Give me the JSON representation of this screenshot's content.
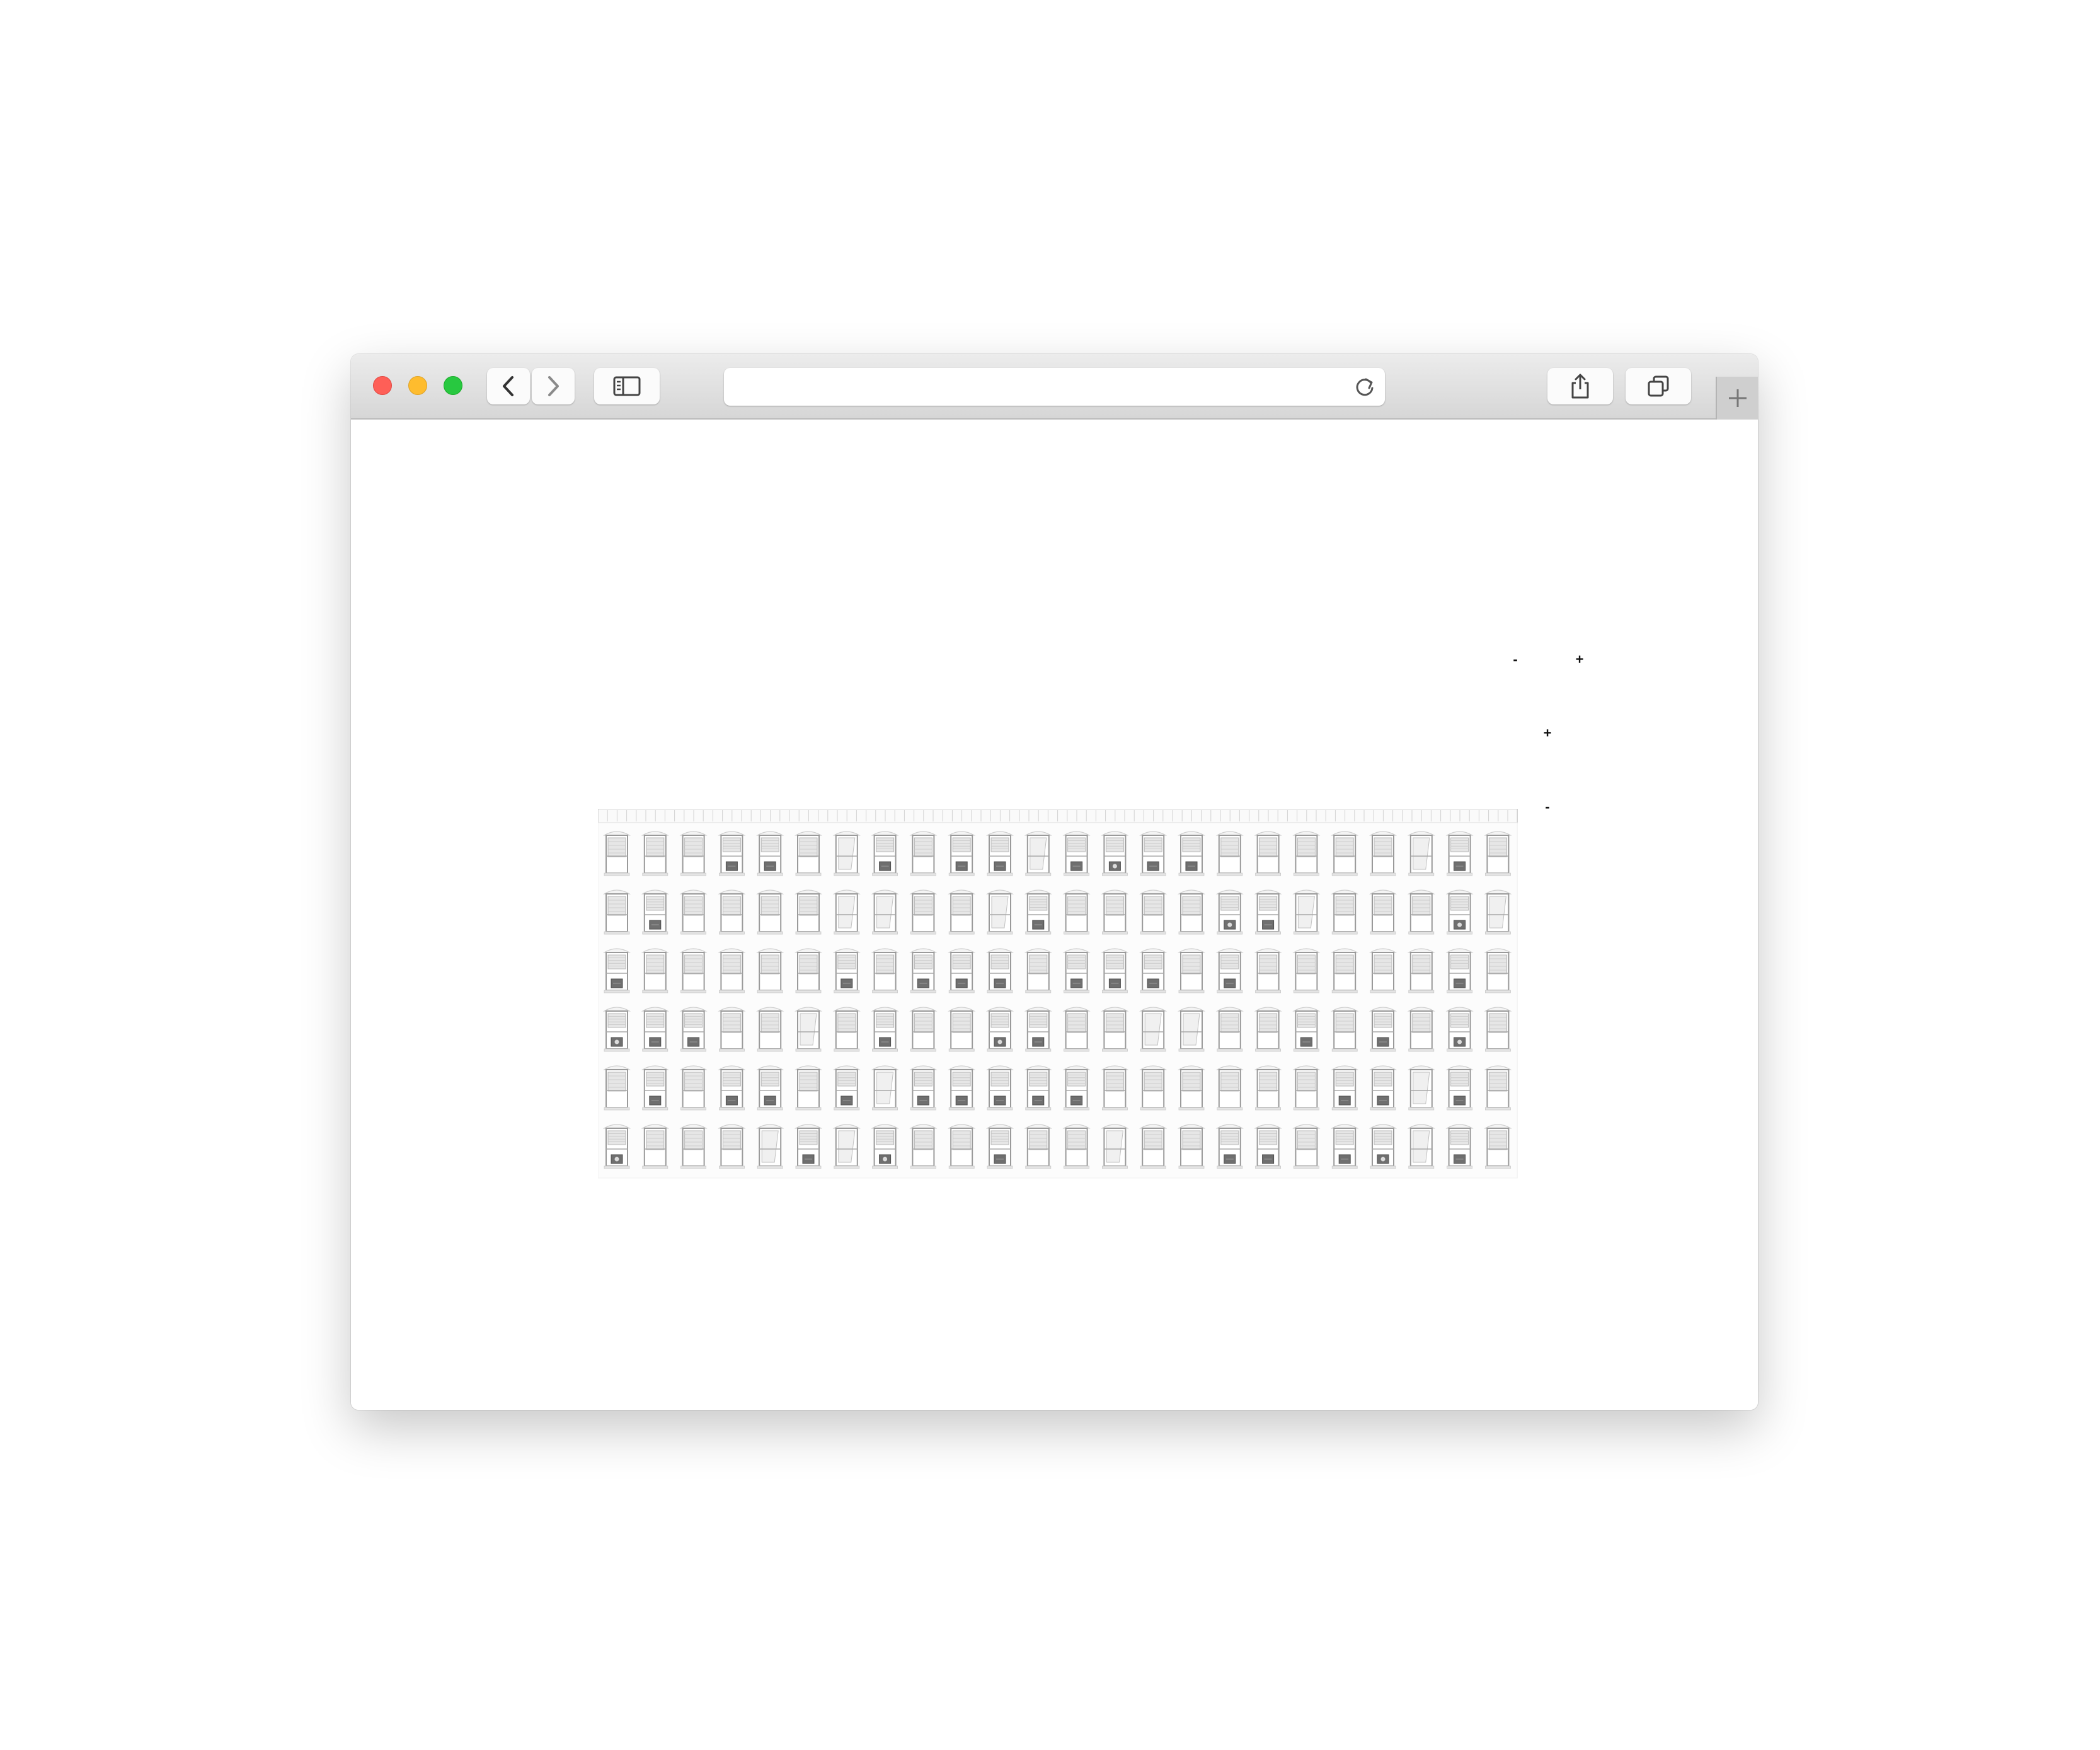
{
  "browser": {
    "address_value": "",
    "icons": {
      "back": "chevron-left-icon",
      "forward": "chevron-right-icon",
      "sidebar": "sidebar-icon",
      "reload": "reload-icon",
      "share": "share-icon",
      "tabs": "tabs-overview-icon",
      "new_tab": "plus-icon"
    }
  },
  "controls": {
    "top_minus": "-",
    "top_plus": "+",
    "side_plus": "+",
    "side_minus": "-"
  },
  "facade": {
    "columns": 24,
    "rows": 6,
    "window_states": [
      "aaaccabcaccbcdccaaaaabca",
      "acaaaabbaabcaaaadcbaaadb",
      "caaaaacacccacccacaaaaaca",
      "dccaabacaadcaabbaacacada",
      "acaccacbcccccaaaaaaccbca",
      "daaabcbdaacaabaaccacdbca"
    ]
  }
}
